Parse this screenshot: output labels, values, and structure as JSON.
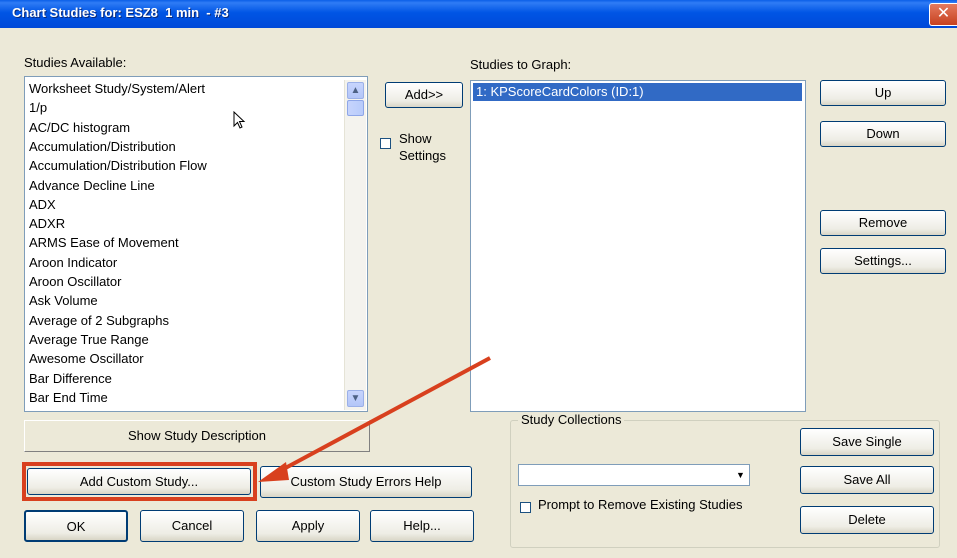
{
  "window": {
    "title": "Chart Studies for: ESZ8  1 min  - #3",
    "close_glyph": "✕"
  },
  "available": {
    "label": "Studies Available:",
    "items": [
      "Worksheet Study/System/Alert",
      "1/p",
      "AC/DC histogram",
      "Accumulation/Distribution",
      "Accumulation/Distribution Flow",
      "Advance Decline Line",
      "ADX",
      "ADXR",
      "ARMS Ease of Movement",
      "Aroon Indicator",
      "Aroon Oscillator",
      "Ask Volume",
      "Average of 2 Subgraphs",
      "Average True Range",
      "Awesome Oscillator",
      "Bar Difference",
      "Bar End Time"
    ]
  },
  "graph": {
    "label": "Studies to Graph:",
    "items": [
      "1: KPScoreCardColors (ID:1)"
    ]
  },
  "buttons": {
    "add": "Add>>",
    "up": "Up",
    "down": "Down",
    "remove": "Remove",
    "settings": "Settings...",
    "show_description": "Show Study Description",
    "add_custom": "Add Custom Study...",
    "custom_errors": "Custom Study Errors Help",
    "ok": "OK",
    "cancel": "Cancel",
    "apply": "Apply",
    "help": "Help...",
    "save_single": "Save Single",
    "save_all": "Save All",
    "delete": "Delete"
  },
  "show_settings": {
    "line1": "Show",
    "line2": "Settings",
    "checked": false
  },
  "collections": {
    "label": "Study Collections",
    "combo_value": "",
    "prompt_label": "Prompt to Remove Existing Studies",
    "prompt_checked": false
  },
  "annotation": {
    "color": "#D8401E"
  },
  "icons": {
    "cursor": "mouse-pointer-icon",
    "scroll_up": "▲",
    "scroll_down": "▼",
    "combo_arrow": "▼"
  }
}
